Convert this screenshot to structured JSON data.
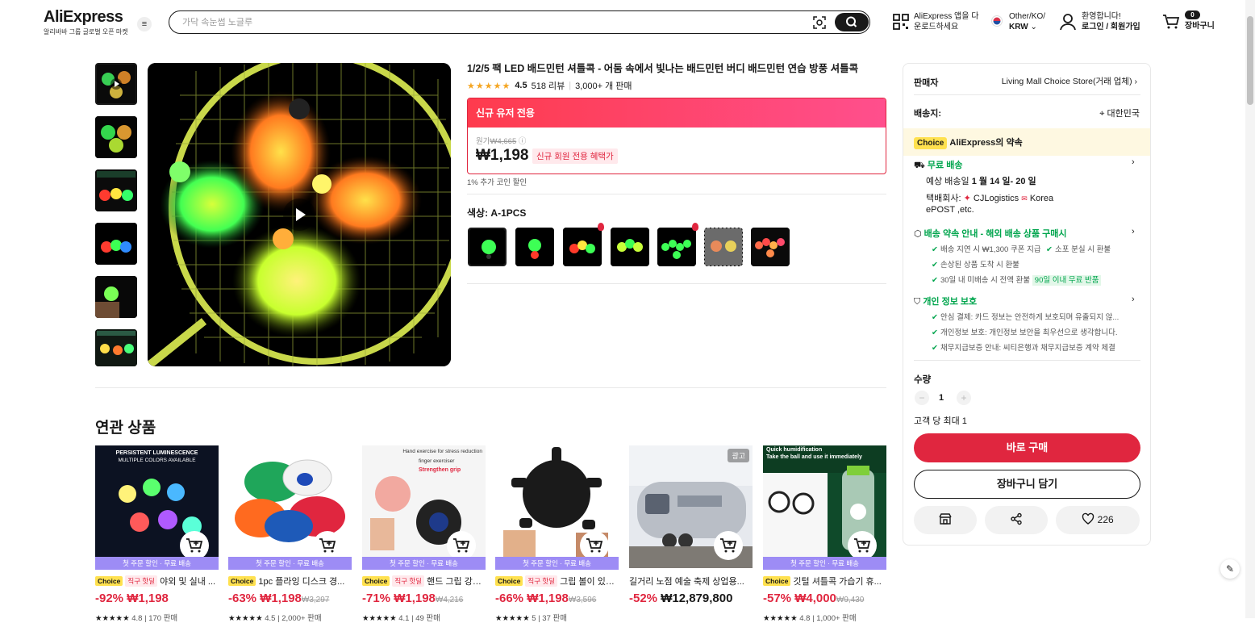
{
  "header": {
    "logo": "AliExpress",
    "logo_sub": "알리바바 그룹 글로벌 오픈 마켓",
    "search_placeholder": "가닥 속눈썹 노글루",
    "app_line1": "AliExpress 앱을 다",
    "app_line2": "운로드하세요",
    "region_line1": "Other/KO/",
    "region_line2": "KRW",
    "account_line1": "환영합니다!",
    "account_line2": "로그인 / 회원가입",
    "cart_count": "0",
    "cart_label": "장바구니"
  },
  "product": {
    "title": "1/2/5 팩 LED 배드민턴 셔틀콕 - 어둠 속에서 빛나는 배드민턴 버디 배드민턴 연습 방풍 셔틀콕",
    "stars": "★★★★★",
    "rating": "4.5",
    "reviews": "518 리뷰",
    "sold": "3,000+ 개 판매",
    "promo_head": "신규 유저 전용",
    "orig_label": "원가",
    "orig_price": "₩4,665",
    "price": "₩1,198",
    "new_member_badge": "신규 회원 전용 혜택가",
    "coin_note": "1% 추가 코인 할인",
    "color_label": "색상: A-1PCS"
  },
  "seller": {
    "label": "판매자",
    "name": "Living Mall Choice Store(거래 업체)",
    "ship_label": "배송지:",
    "ship_to": "대한민국",
    "choice_tag": "Choice",
    "choice_title": "AliExpress의 약속",
    "free_ship": "무료 배송",
    "eta_prefix": "예상 배송일",
    "eta": "1 월 14 일- 20 일",
    "courier_label": "택배회사:",
    "courier_1": "CJLogistics",
    "courier_2": "Korea",
    "courier_3": "ePOST ,etc.",
    "promise_title": "배송 약속 안내 - 해외 배송 상품 구매시",
    "promise_1": "배송 지연 시 ₩1,300 쿠폰 지급",
    "promise_2": "소포 분실 시 환불",
    "promise_3": "손상된 상품 도착 시 환불",
    "promise_4": "30일 내 미배송 시 전액 환불",
    "promise_badge": "90일 이내 무료 반품",
    "privacy_title": "개인 정보 보호",
    "privacy_1": "안심 결제: 카드 정보는 안전하게 보호되며 유출되지 않...",
    "privacy_2": "개인정보 보호: 개인정보 보안을 최우선으로 생각합니다.",
    "privacy_3": "채무지급보증 안내: 씨티은행과 채무지급보증 계약 체결",
    "qty_label": "수량",
    "qty": "1",
    "qty_limit": "고객 당 최대 1",
    "buy_now": "바로 구매",
    "add_cart": "장바구니 담기",
    "wish_count": "226"
  },
  "related": {
    "title": "연관 상품",
    "banner": "첫 주문 할인 · 무료 배송",
    "ad_label": "광고",
    "items": [
      {
        "choice": "Choice",
        "tag": "직구 핫딜",
        "title": "야외 및 실내 ...",
        "discount": "-92%",
        "price": "₩1,198",
        "orig": "",
        "stars": "★★★★★",
        "rating": "4.8",
        "sold": "170 판매"
      },
      {
        "choice": "Choice",
        "tag": "",
        "title": "1pc 플라잉 디스크 경...",
        "discount": "-63%",
        "price": "₩1,198",
        "orig": "₩3,297",
        "stars": "★★★★★",
        "rating": "4.5",
        "sold": "2,000+ 판매"
      },
      {
        "choice": "Choice",
        "tag": "직구 핫딜",
        "title": "핸드 그립 강화...",
        "discount": "-71%",
        "price": "₩1,198",
        "orig": "₩4,216",
        "stars": "★★★★★",
        "rating": "4.1",
        "sold": "49 판매"
      },
      {
        "choice": "Choice",
        "tag": "직구 핫딜",
        "title": "그립 볼이 있는...",
        "discount": "-66%",
        "price": "₩1,198",
        "orig": "₩3,596",
        "stars": "★★★★★",
        "rating": "5",
        "sold": "37 판매"
      },
      {
        "choice": "",
        "tag": "",
        "title": "길거리 노점 예술 축제 상업용...",
        "discount": "-52%",
        "price": "₩12,879,800",
        "orig": "",
        "stars": "",
        "rating": "",
        "sold": ""
      },
      {
        "choice": "Choice",
        "tag": "",
        "title": "깃털 셔틀콕 가습기 휴...",
        "discount": "-57%",
        "price": "₩4,000",
        "orig": "₩9,430",
        "stars": "★★★★★",
        "rating": "4.8",
        "sold": "1,000+ 판매"
      }
    ],
    "img1_top": "PERSISTENT LUMINESCENCE",
    "img1_sub": "MULTIPLE COLORS AVAILABLE",
    "img3_top": "Hand exercise for stress reduction",
    "img3_mid": "finger exerciser",
    "img3_sub": "Strengthen grip",
    "img6_top": "Quick humidification",
    "img6_sub": "Take the ball and use it immediately"
  }
}
